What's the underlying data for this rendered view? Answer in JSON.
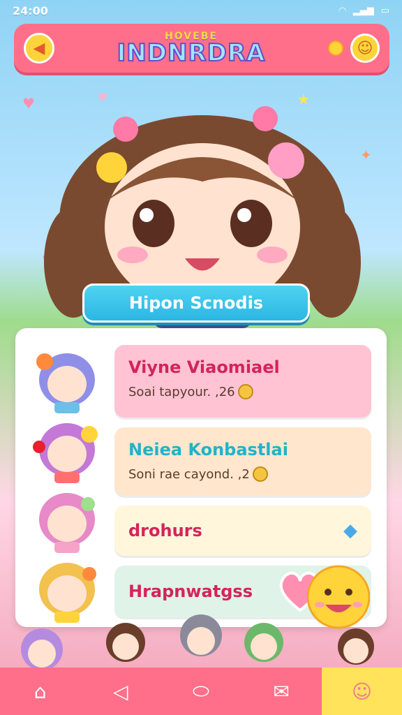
{
  "status": {
    "time": "24:00"
  },
  "header": {
    "logo_top": "HOVEBE",
    "logo_main": "INDNRDRA"
  },
  "character": {
    "name": "Hipon Scnodis"
  },
  "cards": [
    {
      "title": "Viуne Viaomiael",
      "subtitle": "Soai tapyour. ,26"
    },
    {
      "title": "Neiea Konbastlai",
      "subtitle": "Soni rae cayond. ,2"
    },
    {
      "title": "drohurs"
    },
    {
      "title": "Hrapnwatgss"
    }
  ],
  "colors": {
    "accent": "#ff6f8a",
    "nav_active": "#ffe35a",
    "name_plate": "#2bb6e3"
  },
  "nav": [
    {
      "icon": "home-icon"
    },
    {
      "icon": "sound-icon"
    },
    {
      "icon": "center-icon"
    },
    {
      "icon": "mail-icon"
    },
    {
      "icon": "profile-icon"
    }
  ]
}
